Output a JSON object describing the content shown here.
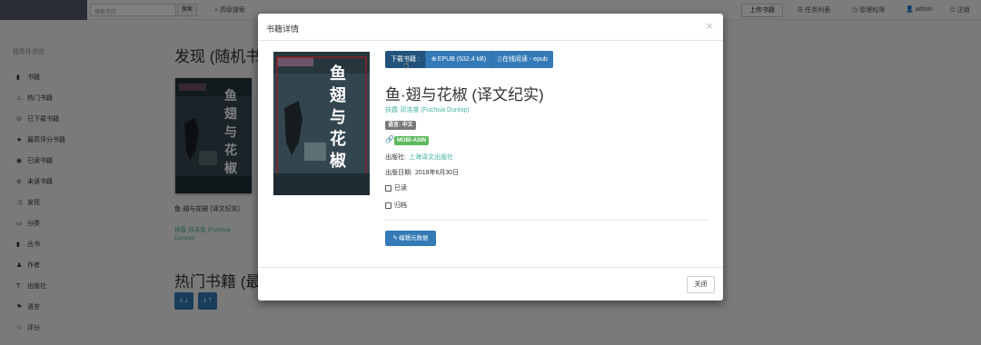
{
  "navbar": {
    "search_placeholder": "搜索书库",
    "search_button": "搜索",
    "advanced_search": "高级搜索",
    "upload_button": "上传书籍",
    "tasks": "任务列表",
    "admin_panel": "管理权限",
    "user": "admin",
    "logout": "注销"
  },
  "sidebar": {
    "title": "按条件浏览",
    "items": [
      {
        "label": "书籍",
        "icon": "book-icon"
      },
      {
        "label": "热门书籍",
        "icon": "fire-icon"
      },
      {
        "label": "已下载书籍",
        "icon": "download-icon"
      },
      {
        "label": "最高评分书籍",
        "icon": "star-icon"
      },
      {
        "label": "已读书籍",
        "icon": "eye-icon"
      },
      {
        "label": "未读书籍",
        "icon": "eye-slash-icon"
      },
      {
        "label": "发现",
        "icon": "random-icon"
      },
      {
        "label": "分类",
        "icon": "inbox-icon"
      },
      {
        "label": "丛书",
        "icon": "bookmark-icon"
      },
      {
        "label": "作者",
        "icon": "user-icon"
      },
      {
        "label": "出版社",
        "icon": "text-size-icon"
      },
      {
        "label": "语言",
        "icon": "flag-icon"
      },
      {
        "label": "评分",
        "icon": "star-empty-icon"
      },
      {
        "label": "文件格式",
        "icon": "file-icon"
      }
    ]
  },
  "main": {
    "discover_heading": "发现 (随机书",
    "hot_heading": "热门书籍 (最",
    "card": {
      "title": "鱼·翅与花椒 (译文纪实)",
      "author": "扶霞·邓洛普 (Fuchsia Dunlop)"
    },
    "sort_asc": "↓⇣",
    "sort_desc": "↓⇡"
  },
  "modal": {
    "title": "书籍详情",
    "close_x": "×",
    "download_label": "下载书籍 :",
    "epub_label": "EPUB (532.4 kB)",
    "read_label": "在线阅读 - epub",
    "book_title": "鱼·翅与花椒 (译文纪实)",
    "author": "扶霞·邓洛普 (Fuchsia Dunlop)",
    "language_badge": "语言: 中文",
    "identifier_badge": "MOBI-ASIN",
    "publisher_label": "出版社:",
    "publisher_value": "上海译文出版社",
    "pubdate_label": "出版日期:",
    "pubdate_value": "2018年6月30日",
    "read_checkbox": "已读",
    "archive_checkbox": "归档",
    "edit_button": "编辑元数据",
    "close_button": "关闭",
    "cover_title": "鱼翅与花椒"
  },
  "colors": {
    "primary": "#337ab7",
    "link": "#45b29d",
    "success": "#5cb85c",
    "default_badge": "#777777"
  }
}
